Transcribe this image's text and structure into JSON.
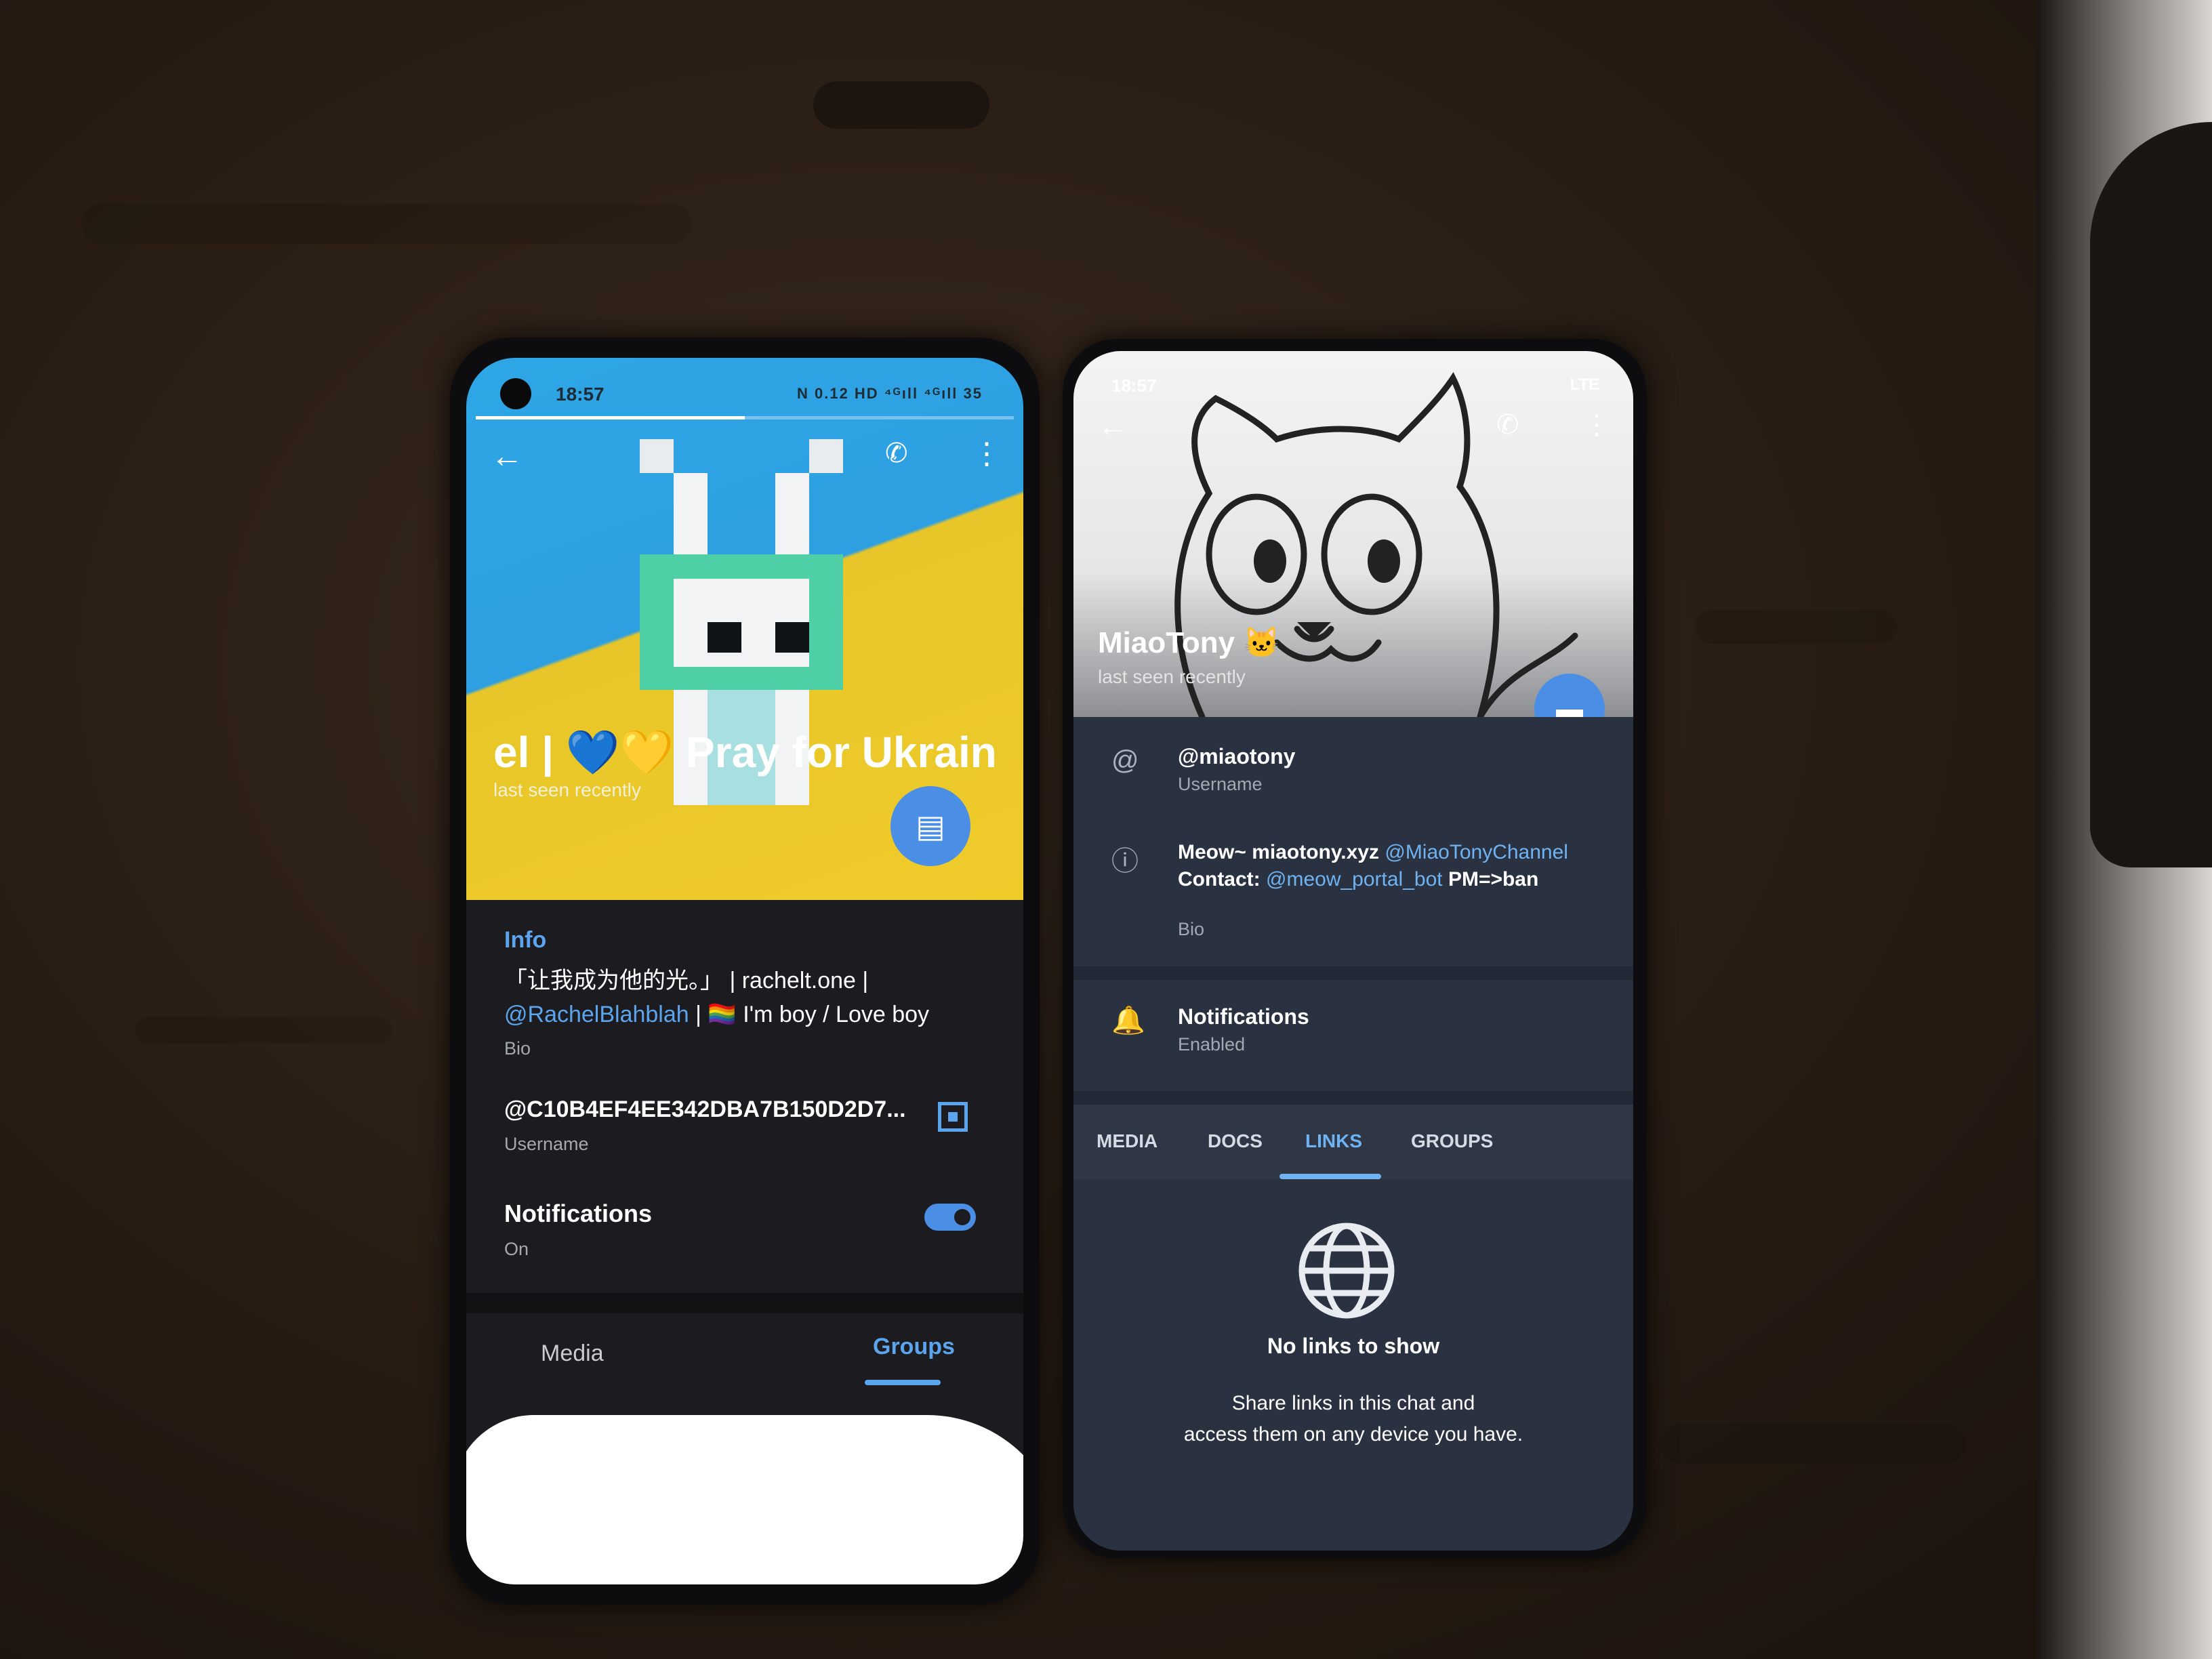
{
  "left_phone": {
    "status_bar": {
      "time": "18:57",
      "icons_text": "N 0.12 HD ⁴ᴳıll ⁴ᴳıll 35"
    },
    "story_progress": 0.5,
    "header": {
      "name": "el | 💙💛 Pray for Ukrain",
      "status": "last seen recently",
      "background_colors": [
        "#2ea6e6",
        "#efcb2a"
      ]
    },
    "info": {
      "section_title": "Info",
      "bio_line1": "「让我成为他的光。」 | rachelt.one |",
      "bio_mention": "@RachelBlahblah",
      "bio_line2_rest": " | 🏳️‍🌈 I'm boy / Love boy",
      "bio_label": "Bio",
      "username": "@C10B4EF4EE342DBA7B150D2D7...",
      "username_label": "Username",
      "notifications": "Notifications",
      "notifications_state": "On"
    },
    "tabs": [
      {
        "label": "Media"
      },
      {
        "label": "Groups",
        "active": true
      }
    ],
    "accent_color": "#5aa5ee"
  },
  "right_phone": {
    "status_bar": {
      "time": "18:57",
      "right_text": "LTE"
    },
    "header": {
      "name": "MiaoTony 🐱",
      "status": "last seen recently"
    },
    "info": {
      "username": "@miaotony",
      "username_label": "Username",
      "bio_prefix": "Meow~ miaotony.xyz ",
      "bio_mention1": "@MiaoTonyChannel",
      "bio_contact": "Contact: ",
      "bio_mention2": "@meow_portal_bot",
      "bio_suffix": " PM=>ban",
      "bio_label": "Bio",
      "notifications": "Notifications",
      "notifications_state": "Enabled"
    },
    "tabs": [
      {
        "label": "MEDIA"
      },
      {
        "label": "DOCS"
      },
      {
        "label": "LINKS",
        "active": true
      },
      {
        "label": "GROUPS"
      }
    ],
    "empty_state": {
      "title": "No links to show",
      "line1": "Share links in this chat and",
      "line2": "access them on any device you have."
    },
    "accent_color": "#6fb3f2"
  }
}
